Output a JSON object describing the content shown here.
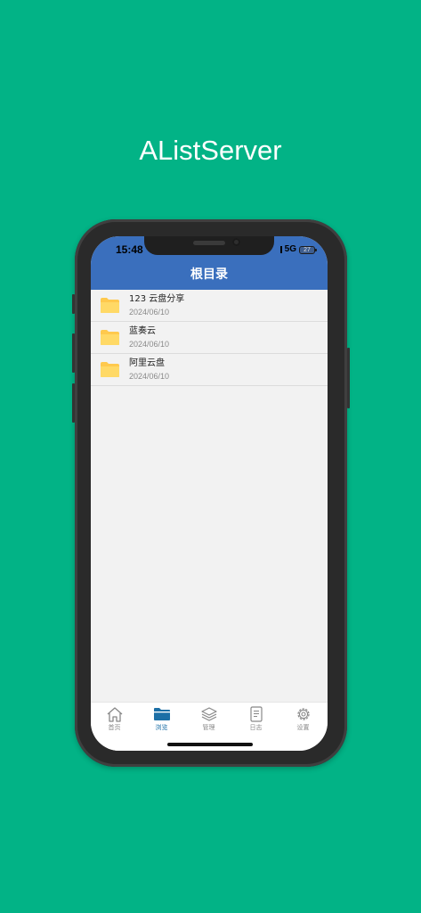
{
  "app_title": "AListServer",
  "status_bar": {
    "time": "15:48",
    "network": "5G",
    "battery": "27"
  },
  "header": {
    "title": "根目录"
  },
  "files": [
    {
      "name": "123 云盘分享",
      "date": "2024/06/10",
      "icon": "folder-icon"
    },
    {
      "name": "蓝奏云",
      "date": "2024/06/10",
      "icon": "folder-icon"
    },
    {
      "name": "阿里云盘",
      "date": "2024/06/10",
      "icon": "folder-icon"
    }
  ],
  "tabs": [
    {
      "label": "首页",
      "icon": "home-icon",
      "active": false
    },
    {
      "label": "浏览",
      "icon": "folder-icon",
      "active": true
    },
    {
      "label": "管理",
      "icon": "layers-icon",
      "active": false
    },
    {
      "label": "日志",
      "icon": "document-icon",
      "active": false
    },
    {
      "label": "设置",
      "icon": "gear-icon",
      "active": false
    }
  ],
  "colors": {
    "background": "#02b386",
    "header": "#3a6fbd",
    "folder": "#ffc94d",
    "active_tab": "#1c6fa6"
  }
}
